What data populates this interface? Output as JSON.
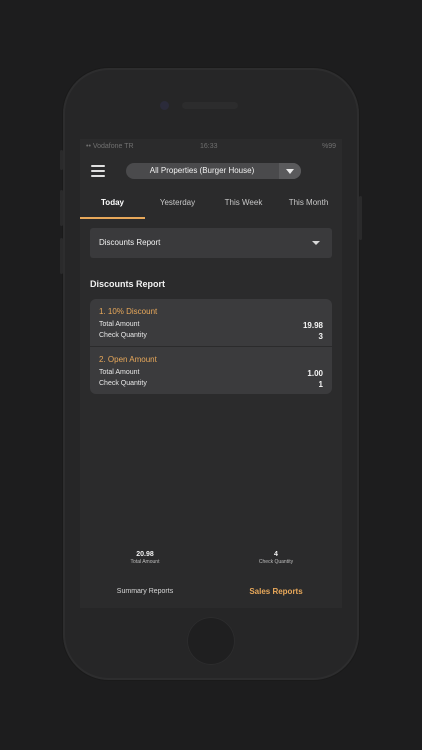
{
  "status_bar": {
    "carrier": "•• Vodafone TR",
    "time": "16:33",
    "battery": "%99"
  },
  "header": {
    "property_selector": "All Properties (Burger House)"
  },
  "tabs": [
    {
      "label": "Today",
      "active": true
    },
    {
      "label": "Yesterday",
      "active": false
    },
    {
      "label": "This Week",
      "active": false
    },
    {
      "label": "This Month",
      "active": false
    }
  ],
  "report_selector": {
    "value": "Discounts Report"
  },
  "section_title": "Discounts Report",
  "discounts": [
    {
      "name": "1. 10% Discount",
      "total_label": "Total Amount",
      "total": "19.98",
      "qty_label": "Check Quantity",
      "qty": "3"
    },
    {
      "name": "2. Open Amount",
      "total_label": "Total Amount",
      "total": "1.00",
      "qty_label": "Check Quantity",
      "qty": "1"
    }
  ],
  "summary": {
    "total_amount": {
      "value": "20.98",
      "label": "Total Amount"
    },
    "check_quantity": {
      "value": "4",
      "label": "Check Quantity"
    }
  },
  "bottom_nav": {
    "summary": "Summary Reports",
    "sales": "Sales Reports"
  },
  "colors": {
    "accent": "#e8a85a",
    "background": "#1d1d1e",
    "screen": "#2b2b2c",
    "card": "#3b3b3d"
  }
}
